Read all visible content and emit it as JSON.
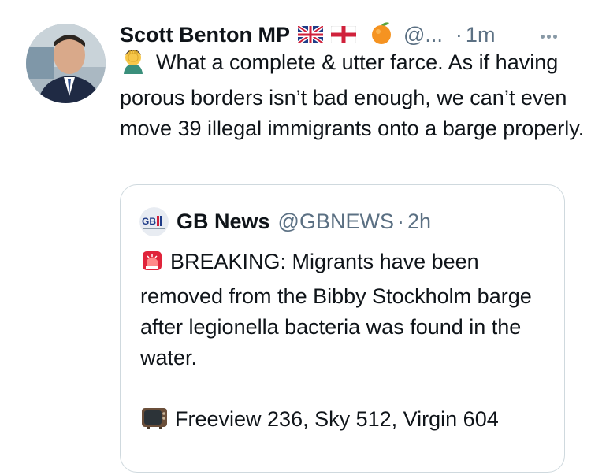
{
  "author": {
    "name": "Scott Benton MP",
    "handle": "@...",
    "separator": "·",
    "time": "1m",
    "badges": [
      "uk-flag-icon",
      "england-flag-icon",
      "orange-emoji-icon"
    ]
  },
  "tweet": {
    "emoji": "facepalm-emoji-icon",
    "text": "What a complete & utter farce. As if having porous borders isn’t bad enough, we can’t even move 39 illegal immigrants onto a barge properly."
  },
  "quoted": {
    "name": "GB News",
    "handle": "@GBNEWS",
    "separator": "·",
    "time": "2h",
    "logo": "gb-news-logo-icon",
    "para1_emoji": "siren-emoji-icon",
    "para1": "BREAKING: Migrants have been removed from the Bibby Stockholm barge after legionella bacteria was found in the water.",
    "para2_emoji": "television-emoji-icon",
    "para2": "Freeview 236, Sky 512, Virgin 604"
  },
  "colors": {
    "text": "#0f1419",
    "secondary": "#5b7083",
    "border": "#cfd9de"
  }
}
